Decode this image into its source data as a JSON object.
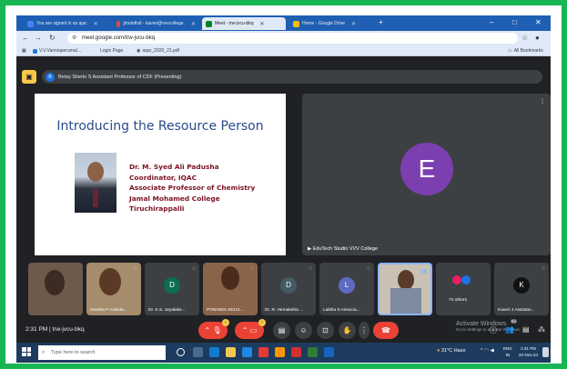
{
  "browser": {
    "tabs": [
      {
        "label": "You are signed in as ajac",
        "icon": "drive-icon",
        "color": "#4285f4"
      },
      {
        "label": "photofixit - kaveri@vvvcollege.",
        "icon": "gmail-icon",
        "color": "#ea4335"
      },
      {
        "label": "Meet - trw-jvcu-bkq",
        "icon": "meet-icon",
        "color": "#00832d"
      },
      {
        "label": "Home - Google Drive",
        "icon": "drive-icon",
        "color": "#fbbc04"
      }
    ],
    "url": "meet.google.com/trw-jvcu-bkq",
    "bookmarks": [
      "V.V.Vanniaperumal...",
      "Login Page",
      "aqar_2020_21.pdf"
    ],
    "all_bookmarks": "All Bookmarks"
  },
  "meet": {
    "presenter_initial": "B",
    "presenter_label": "Betsy Sherin S Assistant Professor of CDF (Presenting)",
    "slide": {
      "title": "Introducing the Resource Person",
      "lines": [
        "Dr. M. Syed Ali Padusha",
        "Coordinator, IQAC",
        "Associate Professor of Chemistry",
        "Jamal Mohamed College",
        "Tiruchirappalli"
      ]
    },
    "main_tile": {
      "initial": "E",
      "label": "EduTech Studio VVV College",
      "color": "#7b3fb0"
    },
    "thumbnails": [
      {
        "label": "",
        "initial": "",
        "color": ""
      },
      {
        "label": "Geetha P Assista...",
        "initial": "",
        "color": ""
      },
      {
        "label": "Dr. K.S. Jeyalaks...",
        "initial": "D",
        "color": "#0b6e4f"
      },
      {
        "label": "PONNIEN SELVI...",
        "initial": "",
        "color": ""
      },
      {
        "label": "Dr. R. Hemaletha ...",
        "initial": "D",
        "color": "#455a64"
      },
      {
        "label": "Lalitha S Associa...",
        "initial": "L",
        "color": "#5c6bc0"
      },
      {
        "label": "",
        "initial": "",
        "color": ""
      },
      {
        "label": "74 others",
        "initial": "",
        "color": ""
      },
      {
        "label": "Kaveri J Assistan...",
        "initial": "K",
        "color": "#111111"
      }
    ],
    "time": "2:31 PM",
    "meeting_code": "trw-jvcu-bkq",
    "activate_title": "Activate Windows",
    "activate_sub": "Go to Settings to activate Windows.",
    "participants_count": "84"
  },
  "taskbar": {
    "search_placeholder": "Type here to search",
    "weather": "31°C Haze",
    "lang": "ENG",
    "region": "IN",
    "clock_time": "2:31 PM",
    "clock_date": "22-Nov-24"
  }
}
